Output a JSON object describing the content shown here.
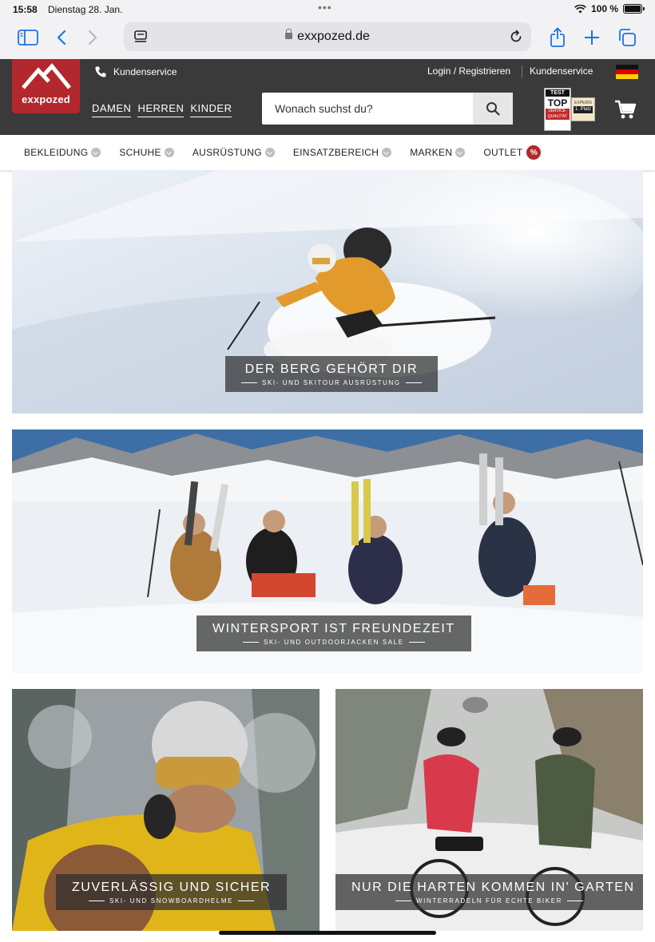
{
  "status_bar": {
    "time": "15:58",
    "date": "Dienstag 28. Jan.",
    "battery": "100 %"
  },
  "browser": {
    "url": "exxpozed.de",
    "accent_color": "#1a73e8",
    "icons": [
      "sidebar-icon",
      "back-icon",
      "forward-icon",
      "reader-icon",
      "lock-icon",
      "reload-icon",
      "share-icon",
      "new-tab-icon",
      "tabs-icon"
    ]
  },
  "header": {
    "logo_text": "exxpozed",
    "brand_color": "#b3282d",
    "service_label": "Kundenservice",
    "login_label": "Login / Registrieren",
    "service_label_right": "Kundenservice",
    "gender_nav": [
      "DAMEN",
      "HERREN",
      "KINDER"
    ],
    "search_placeholder": "Wonach suchst du?",
    "badge_top": {
      "line1": "TEST BILD",
      "line2": "TOP",
      "line3": "SERVICE-QUALITÄT"
    },
    "badge_second": {
      "line1": "EXPERIS",
      "line2": "1. Platz"
    }
  },
  "category_nav": {
    "items": [
      "BEKLEIDUNG",
      "SCHUHE",
      "AUSRÜSTUNG",
      "EINSATZBEREICH",
      "MARKEN",
      "OUTLET"
    ],
    "outlet_badge": "%"
  },
  "banners": [
    {
      "title": "DER BERG GEHÖRT DIR",
      "subtitle": "SKI- UND SKITOUR AUSRÜSTUNG"
    },
    {
      "title": "WINTERSPORT IST FREUNDEZEIT",
      "subtitle": "SKI- UND OUTDOORJACKEN SALE"
    },
    {
      "title": "ZUVERLÄSSIG UND SICHER",
      "subtitle": "SKI- UND SNOWBOARDHELME"
    },
    {
      "title": "NUR DIE HARTEN KOMMEN IN' GARTEN",
      "subtitle": "WINTERRADELN FÜR ECHTE BIKER"
    }
  ]
}
